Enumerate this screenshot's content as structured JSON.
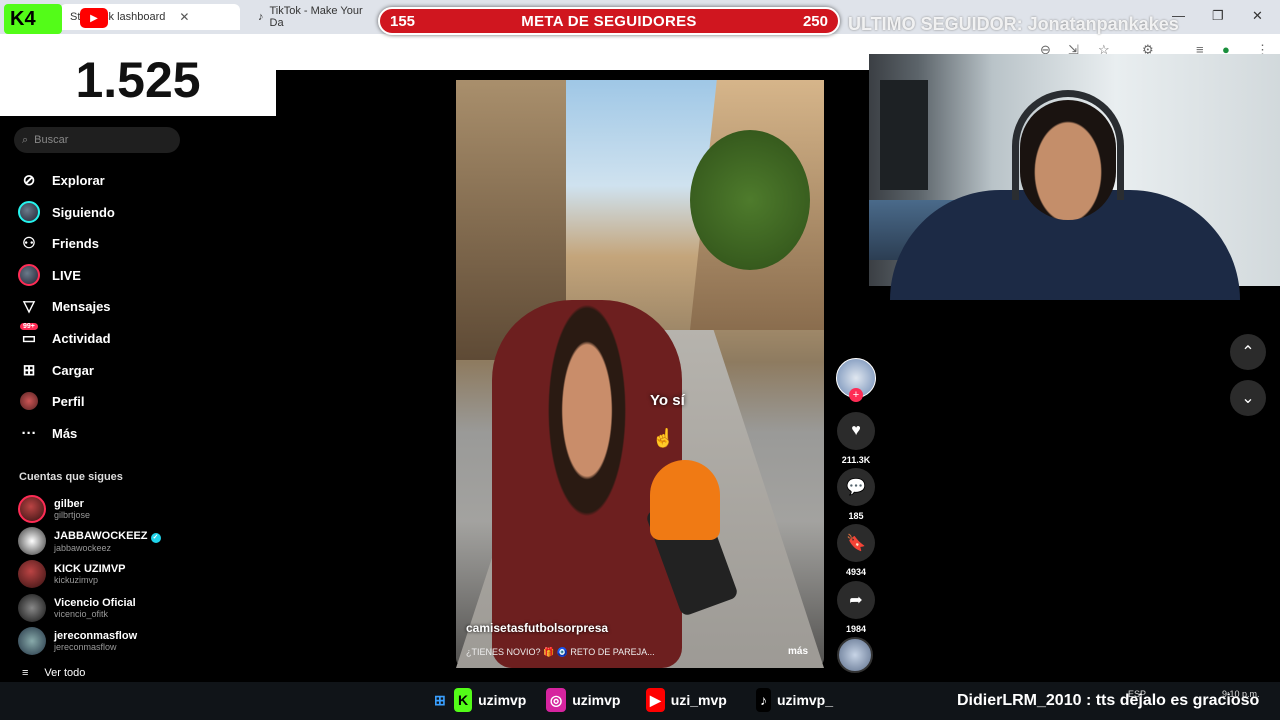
{
  "browser": {
    "tabs": [
      {
        "label": "Stre  Kick  lashboard"
      },
      {
        "label": "TikTok - Make Your Da"
      }
    ],
    "window_controls": [
      "—",
      "❐",
      "✕"
    ]
  },
  "overlay": {
    "goal_start": "155",
    "goal_title": "META DE SEGUIDORES",
    "goal_end": "250",
    "last_follower": "ULTIMO SEGUIDOR: Jonatanpankakes",
    "follower_count": "1.525",
    "kick_badge": "K4",
    "colors": {
      "goal_red": "#d0161f",
      "kick_green": "#53fc18"
    }
  },
  "sidebar": {
    "search_placeholder": "Buscar",
    "nav": [
      {
        "label": "Explorar",
        "icon": "compass-icon"
      },
      {
        "label": "Siguiendo",
        "icon": "following-avatar-icon"
      },
      {
        "label": "Friends",
        "icon": "friends-icon"
      },
      {
        "label": "LIVE",
        "icon": "live-icon"
      },
      {
        "label": "Mensajes",
        "icon": "messages-icon"
      },
      {
        "label": "Actividad",
        "icon": "activity-icon",
        "badge": "99+"
      },
      {
        "label": "Cargar",
        "icon": "upload-icon"
      },
      {
        "label": "Perfil",
        "icon": "profile-icon"
      },
      {
        "label": "Más",
        "icon": "more-icon"
      }
    ],
    "following_title": "Cuentas que sigues",
    "accounts": [
      {
        "name": "gilber",
        "user": "gilbrtjose",
        "verified": false
      },
      {
        "name": "JABBAWOCKEEZ",
        "user": "jabbawockeez",
        "verified": true
      },
      {
        "name": "KICK UZIMVP",
        "user": "kickuzimvp",
        "verified": false
      },
      {
        "name": "Vicencio Oficial",
        "user": "vicencio_ofitk",
        "verified": false
      },
      {
        "name": "jereconmasflow",
        "user": "jereconmasflow",
        "verified": false
      }
    ],
    "see_all": "Ver todo"
  },
  "video": {
    "caption": "Yo sí",
    "author": "camisetasfutbolsorpresa",
    "description": "¿TIENES NOVIO? 🎁 🧿 RETO DE PAREJA...",
    "more": "más",
    "likes": "211.3K",
    "comments": "185",
    "saves": "4934",
    "shares": "1984"
  },
  "taskbar": {
    "social_handles": [
      "uzimvp",
      "uzimvp",
      "uzi_mvp",
      "uzimvp_"
    ],
    "ticker": "DidierLRM_2010 : tts dejalo es gracioso",
    "lang": "ESP",
    "time": "9:10 p.m."
  }
}
